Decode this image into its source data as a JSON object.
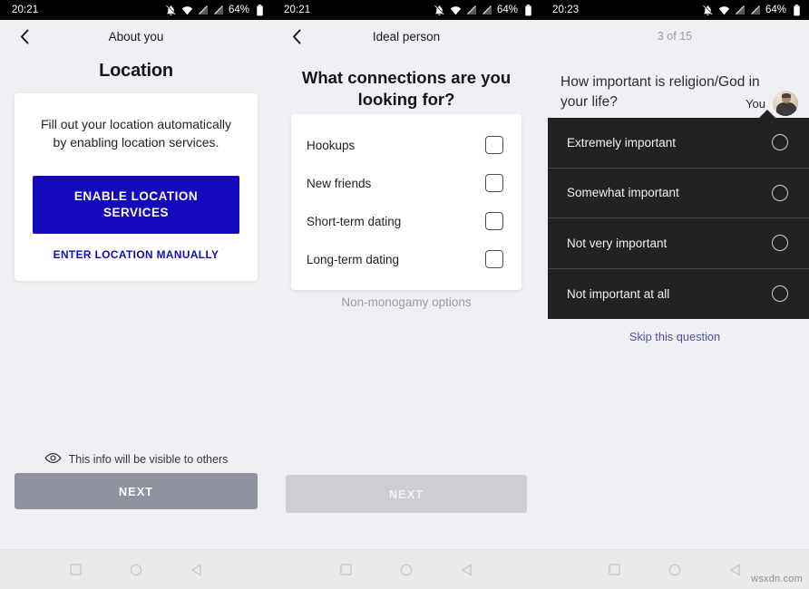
{
  "screens": [
    {
      "status": {
        "time": "20:21",
        "battery": "64%",
        "icons": [
          "bell-muted-icon",
          "wifi-icon",
          "signal-off-icon",
          "signal-off-icon",
          "battery-icon"
        ]
      },
      "header": {
        "back": "back-chevron-icon",
        "title": "About you"
      },
      "page_title": "Location",
      "card": {
        "description": "Fill out your location automatically by enabling location services.",
        "primary_button": "ENABLE LOCATION SERVICES",
        "secondary_button": "ENTER LOCATION MANUALLY"
      },
      "visibility_note": "This info will be visible to others",
      "visibility_icon": "eye-icon",
      "next_button": "NEXT"
    },
    {
      "status": {
        "time": "20:21",
        "battery": "64%"
      },
      "header": {
        "back": "back-chevron-icon",
        "title": "Ideal person"
      },
      "question": "What connections are you looking for?",
      "options": [
        {
          "label": "Hookups",
          "checked": false
        },
        {
          "label": "New friends",
          "checked": false
        },
        {
          "label": "Short-term dating",
          "checked": false
        },
        {
          "label": "Long-term dating",
          "checked": false
        }
      ],
      "link": "Non-monogamy options",
      "next_button": "NEXT"
    },
    {
      "status": {
        "time": "20:23",
        "battery": "64%"
      },
      "step": "3 of 15",
      "question": "How important is religion/God in your life?",
      "you_label": "You",
      "avatar": "user-avatar",
      "options": [
        {
          "label": "Extremely important",
          "selected": false
        },
        {
          "label": "Somewhat important",
          "selected": false
        },
        {
          "label": "Not very important",
          "selected": false
        },
        {
          "label": "Not important at all",
          "selected": false
        }
      ],
      "skip_link": "Skip this question"
    }
  ],
  "navbar": {
    "recents": "square-icon",
    "home": "circle-icon",
    "back": "triangle-back-icon"
  },
  "watermark": "wsxdn.com",
  "colors": {
    "accent_blue": "#1409bd",
    "link_blue": "#4c50a8",
    "panel_bg": "#eff0f4",
    "dark_panel": "#222222",
    "next_active": "#8e939f",
    "next_disabled": "#ccced2"
  }
}
